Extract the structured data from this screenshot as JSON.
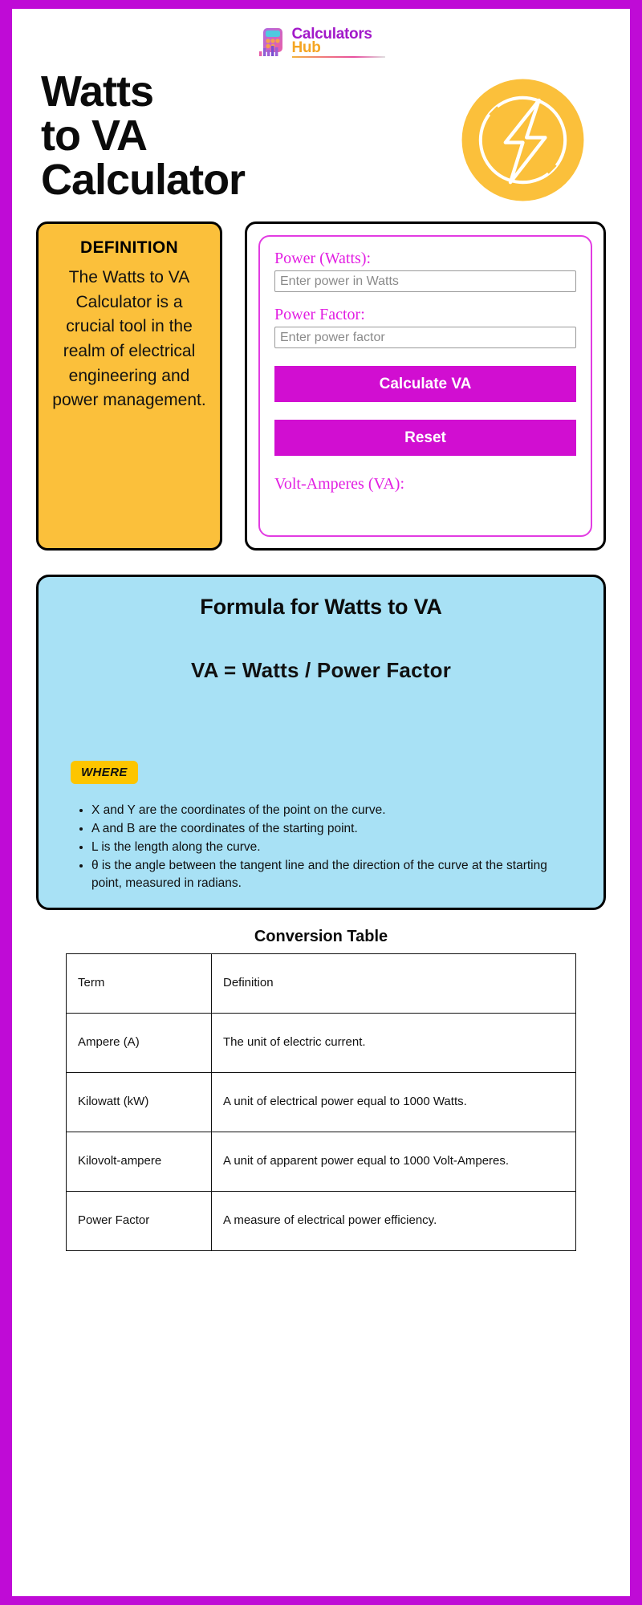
{
  "brand": {
    "line1": "Calculators",
    "line2": "Hub",
    "mark_icon": "calculator-icon"
  },
  "hero": {
    "title_line1": "Watts",
    "title_line2": "to VA",
    "title_line3": "Calculator",
    "icon": "lightning-bolt-circle-icon",
    "icon_color": "#fbc03b"
  },
  "definition": {
    "heading": "DEFINITION",
    "body": "The Watts to VA Calculator is a crucial tool in the realm of electrical engineering and power management."
  },
  "calculator": {
    "power_label": "Power (Watts):",
    "power_placeholder": "Enter power in Watts",
    "power_value": "",
    "factor_label": "Power Factor:",
    "factor_placeholder": "Enter power factor",
    "factor_value": "",
    "calculate_label": "Calculate VA",
    "reset_label": "Reset",
    "result_label": "Volt-Amperes (VA):",
    "accent_color": "#d10ed1"
  },
  "formula": {
    "title": "Formula for Watts to VA",
    "equation": "VA = Watts / Power Factor",
    "where_badge": "WHERE",
    "bullets": [
      "X and Y are the coordinates of the point on the curve.",
      "A and B are the coordinates of the starting point.",
      "L is the length along the curve.",
      "θ is the angle between the tangent line and the direction of the curve at the starting point, measured in radians."
    ],
    "bg_color": "#a8e1f5"
  },
  "conversion_table": {
    "title": "Conversion Table",
    "headers": [
      "Term",
      "Definition"
    ],
    "rows": [
      [
        "Ampere (A)",
        "The unit of electric current."
      ],
      [
        "Kilowatt (kW)",
        "A unit of electrical power equal to 1000 Watts."
      ],
      [
        "Kilovolt-ampere",
        "A unit of apparent power equal to 1000 Volt-Amperes."
      ],
      [
        "Power Factor",
        "A measure of electrical power efficiency."
      ]
    ]
  },
  "theme": {
    "border_color": "#bf0bd6",
    "yellow": "#fbc03b",
    "blue": "#a8e1f5"
  }
}
